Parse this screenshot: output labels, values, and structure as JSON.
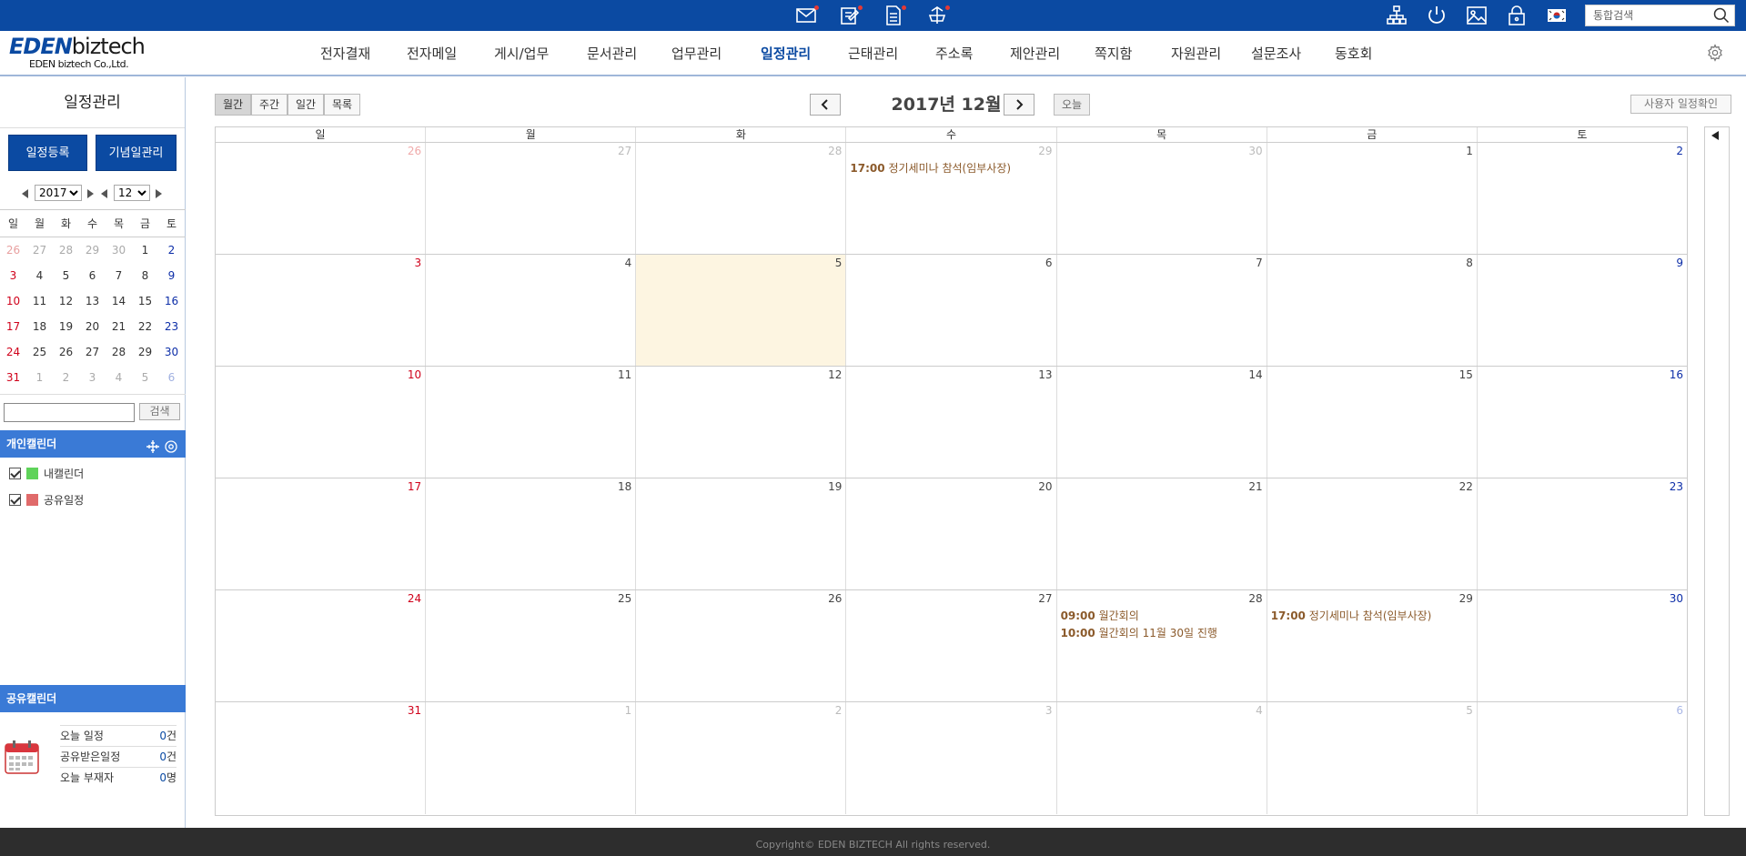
{
  "topbar": {
    "search_placeholder": "통합검색",
    "icons": [
      "mail-icon",
      "approval-icon",
      "document-icon",
      "share-icon",
      "org-chart-icon",
      "power-icon",
      "image-icon",
      "lock-icon",
      "flag-icon",
      "search-icon"
    ],
    "badge_color": "#e53935"
  },
  "header": {
    "logo_eden": "EDEN",
    "logo_biz": "biztech",
    "logo_company": "EDEN biztech Co.,Ltd.",
    "nav": [
      "전자결재",
      "전자메일",
      "게시/업무",
      "문서관리",
      "업무관리",
      "일정관리",
      "근태관리",
      "주소록",
      "제안관리",
      "쪽지함",
      "자원관리",
      "설문조사",
      "동호회"
    ],
    "active_nav": "일정관리",
    "brand_color": "#0b4aa2"
  },
  "sidebar": {
    "title": "일정관리",
    "btn_register": "일정등록",
    "btn_anniversary": "기념일관리",
    "year": "2017",
    "month": "12",
    "weekdays": [
      "일",
      "월",
      "화",
      "수",
      "목",
      "금",
      "토"
    ],
    "mini_weeks": [
      [
        "26",
        "27",
        "28",
        "29",
        "30",
        "1",
        "2"
      ],
      [
        "3",
        "4",
        "5",
        "6",
        "7",
        "8",
        "9"
      ],
      [
        "10",
        "11",
        "12",
        "13",
        "14",
        "15",
        "16"
      ],
      [
        "17",
        "18",
        "19",
        "20",
        "21",
        "22",
        "23"
      ],
      [
        "24",
        "25",
        "26",
        "27",
        "28",
        "29",
        "30"
      ],
      [
        "31",
        "1",
        "2",
        "3",
        "4",
        "5",
        "6"
      ]
    ],
    "search_button": "검색",
    "personal_header": "개인캘린더",
    "calendars": [
      {
        "label": "내캘린더",
        "color": "#5fd35a"
      },
      {
        "label": "공유일정",
        "color": "#e06a6a"
      }
    ],
    "shared_header": "공유캘린더",
    "stats": [
      {
        "label": "오늘 일정",
        "count": "0",
        "unit": "건"
      },
      {
        "label": "공유받은일정",
        "count": "0",
        "unit": "건"
      },
      {
        "label": "오늘 부재자",
        "count": "0",
        "unit": "명"
      }
    ]
  },
  "toolbar": {
    "views": [
      "월간",
      "주간",
      "일간",
      "목록"
    ],
    "active_view": "월간",
    "month_title": "2017년 12월",
    "today": "오늘",
    "user_schedule": "사용자 일정확인"
  },
  "calendar": {
    "weekdays": [
      "일",
      "월",
      "화",
      "수",
      "목",
      "금",
      "토"
    ],
    "weeks": [
      [
        {
          "day": "26",
          "dim": true,
          "events": []
        },
        {
          "day": "27",
          "dim": true,
          "events": []
        },
        {
          "day": "28",
          "dim": true,
          "events": []
        },
        {
          "day": "29",
          "dim": true,
          "events": [
            {
              "time": "17:00",
              "title": "정기세미나 참석(임부사장)"
            }
          ]
        },
        {
          "day": "30",
          "dim": true,
          "events": []
        },
        {
          "day": "1",
          "dim": false,
          "events": []
        },
        {
          "day": "2",
          "dim": false,
          "events": []
        }
      ],
      [
        {
          "day": "3",
          "dim": false,
          "events": []
        },
        {
          "day": "4",
          "dim": false,
          "events": []
        },
        {
          "day": "5",
          "dim": false,
          "today": true,
          "events": []
        },
        {
          "day": "6",
          "dim": false,
          "events": []
        },
        {
          "day": "7",
          "dim": false,
          "events": []
        },
        {
          "day": "8",
          "dim": false,
          "events": []
        },
        {
          "day": "9",
          "dim": false,
          "events": []
        }
      ],
      [
        {
          "day": "10",
          "dim": false,
          "events": []
        },
        {
          "day": "11",
          "dim": false,
          "events": []
        },
        {
          "day": "12",
          "dim": false,
          "events": []
        },
        {
          "day": "13",
          "dim": false,
          "events": []
        },
        {
          "day": "14",
          "dim": false,
          "events": []
        },
        {
          "day": "15",
          "dim": false,
          "events": []
        },
        {
          "day": "16",
          "dim": false,
          "events": []
        }
      ],
      [
        {
          "day": "17",
          "dim": false,
          "events": []
        },
        {
          "day": "18",
          "dim": false,
          "events": []
        },
        {
          "day": "19",
          "dim": false,
          "events": []
        },
        {
          "day": "20",
          "dim": false,
          "events": []
        },
        {
          "day": "21",
          "dim": false,
          "events": []
        },
        {
          "day": "22",
          "dim": false,
          "events": []
        },
        {
          "day": "23",
          "dim": false,
          "events": []
        }
      ],
      [
        {
          "day": "24",
          "dim": false,
          "events": []
        },
        {
          "day": "25",
          "dim": false,
          "events": []
        },
        {
          "day": "26",
          "dim": false,
          "events": []
        },
        {
          "day": "27",
          "dim": false,
          "events": []
        },
        {
          "day": "28",
          "dim": false,
          "events": [
            {
              "time": "09:00",
              "title": "월간회의"
            },
            {
              "time": "10:00",
              "title": "월간회의 11월 30일 진행"
            }
          ]
        },
        {
          "day": "29",
          "dim": false,
          "events": [
            {
              "time": "17:00",
              "title": "정기세미나 참석(임부사장)"
            }
          ]
        },
        {
          "day": "30",
          "dim": false,
          "events": []
        }
      ],
      [
        {
          "day": "31",
          "dim": false,
          "events": []
        },
        {
          "day": "1",
          "dim": true,
          "events": []
        },
        {
          "day": "2",
          "dim": true,
          "events": []
        },
        {
          "day": "3",
          "dim": true,
          "events": []
        },
        {
          "day": "4",
          "dim": true,
          "events": []
        },
        {
          "day": "5",
          "dim": true,
          "events": []
        },
        {
          "day": "6",
          "dim": true,
          "events": []
        }
      ]
    ],
    "today_color": "#fdf5e1",
    "event_color": "#8b5a2b"
  },
  "footer": {
    "copyright": "Copyright© EDEN BIZTECH All rights reserved."
  }
}
